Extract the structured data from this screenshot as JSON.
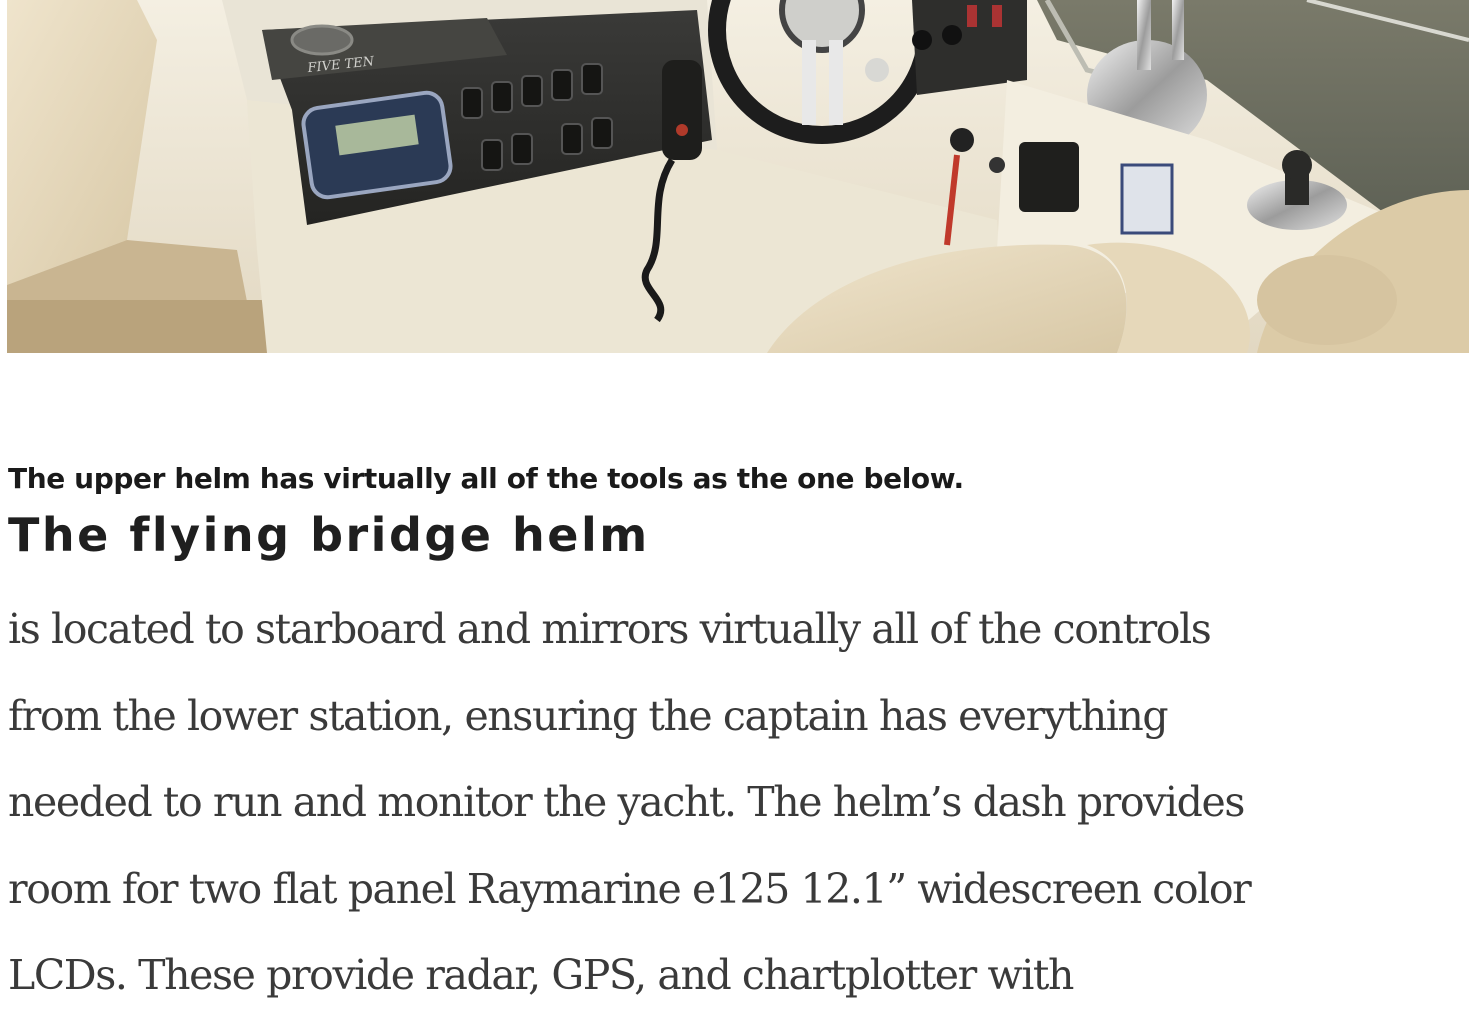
{
  "photo": {
    "panel_brand": "FIVE TEN"
  },
  "caption": "The upper helm has virtually all of the tools as the one below.",
  "subhead": "The flying bridge helm",
  "body_lines": [
    "is located to starboard and mirrors virtually all of the controls",
    "from the lower station, ensuring the captain has everything",
    "needed to run and monitor the yacht. The helm’s dash provides",
    "room for two flat panel Raymarine e125 12.1” widescreen color",
    "LCDs. These provide radar, GPS, and chartplotter with"
  ]
}
